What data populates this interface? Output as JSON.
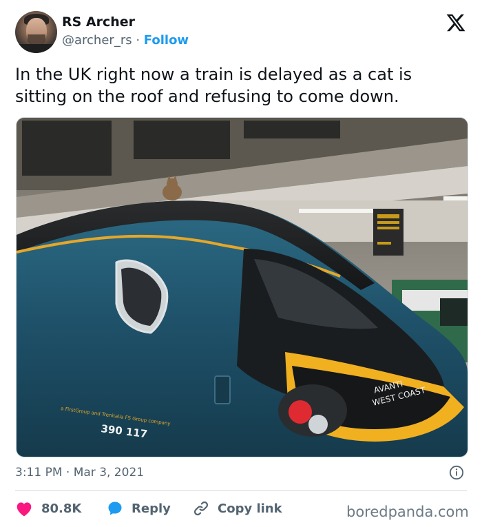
{
  "author": {
    "name": "RS Archer",
    "handle": "@archer_rs",
    "separator": "·",
    "follow_label": "Follow"
  },
  "tweet": {
    "text": "In the UK right now a train is delayed as a cat is sitting on the roof and refusing to come down.",
    "time": "3:11 PM · Mar 3, 2021"
  },
  "photo": {
    "train_brand": "AVANTI\nWEST COAST",
    "train_number": "390 117",
    "train_small_text": "a FirstGroup and Trenitalia FS Group company"
  },
  "actions": {
    "like_count": "80.8K",
    "reply_label": "Reply",
    "copy_link_label": "Copy link"
  },
  "icons": {
    "logo": "x-logo-icon",
    "like": "heart-icon",
    "reply": "speech-bubble-icon",
    "copy": "link-icon",
    "info": "info-icon"
  },
  "colors": {
    "link_blue": "#1d9bf0",
    "like_pink": "#f91880",
    "train_teal": "#1d4f66",
    "train_yellow": "#f0b020"
  },
  "watermark": "boredpanda.com"
}
